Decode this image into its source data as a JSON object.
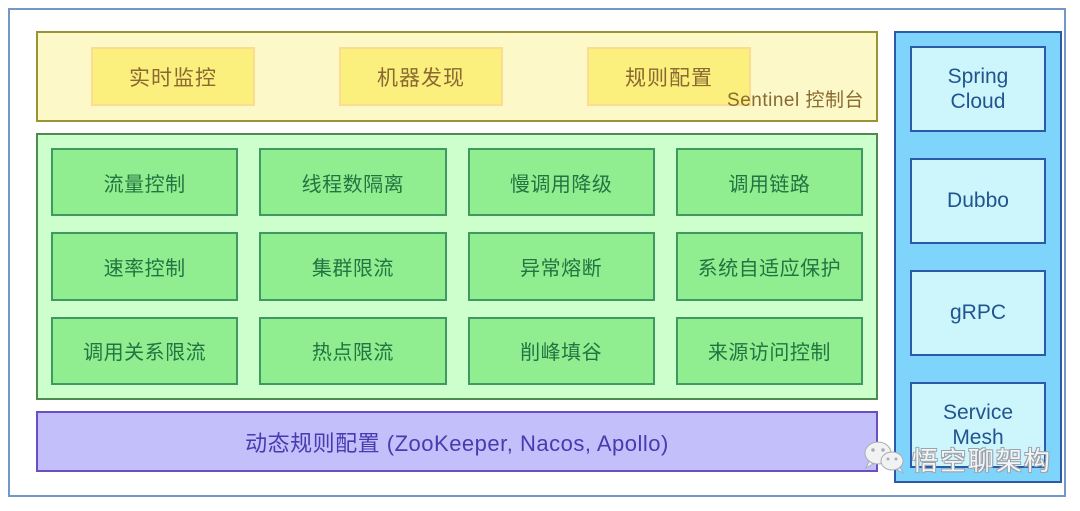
{
  "diagram": {
    "console": {
      "label": "Sentinel 控制台",
      "boxes": [
        {
          "label": "实时监控"
        },
        {
          "label": "机器发现"
        },
        {
          "label": "规则配置"
        }
      ]
    },
    "core": {
      "boxes": [
        {
          "label": "流量控制"
        },
        {
          "label": "线程数隔离"
        },
        {
          "label": "慢调用降级"
        },
        {
          "label": "调用链路"
        },
        {
          "label": "速率控制"
        },
        {
          "label": "集群限流"
        },
        {
          "label": "异常熔断"
        },
        {
          "label": "系统自适应保护"
        },
        {
          "label": "调用关系限流"
        },
        {
          "label": "热点限流"
        },
        {
          "label": "削峰填谷"
        },
        {
          "label": "来源访问控制"
        }
      ]
    },
    "rules": {
      "label": "动态规则配置 (ZooKeeper, Nacos, Apollo)"
    },
    "adapters": {
      "boxes": [
        {
          "label": "Spring\nCloud"
        },
        {
          "label": "Dubbo"
        },
        {
          "label": "gRPC"
        },
        {
          "label": "Service\nMesh"
        }
      ]
    },
    "watermark": {
      "text": "悟空聊架构",
      "icon": "wechat-icon"
    },
    "colors": {
      "frame_border": "#7596c8",
      "console_bg": "#fcf8c8",
      "console_border": "#9c9434",
      "console_box_bg": "#fbef7e",
      "console_text": "#8a6a30",
      "core_bg": "#ccffcc",
      "core_border": "#4f8a4f",
      "core_box_bg": "#90ee90",
      "core_text": "#207540",
      "rules_bg": "#c3bffa",
      "rules_border": "#6c4ec0",
      "rules_text": "#4a3ab0",
      "adapter_bg": "#7fd4fc",
      "adapter_box_bg": "#ccf5fc",
      "adapter_border": "#2a5aa8",
      "adapter_text": "#22558f"
    }
  }
}
